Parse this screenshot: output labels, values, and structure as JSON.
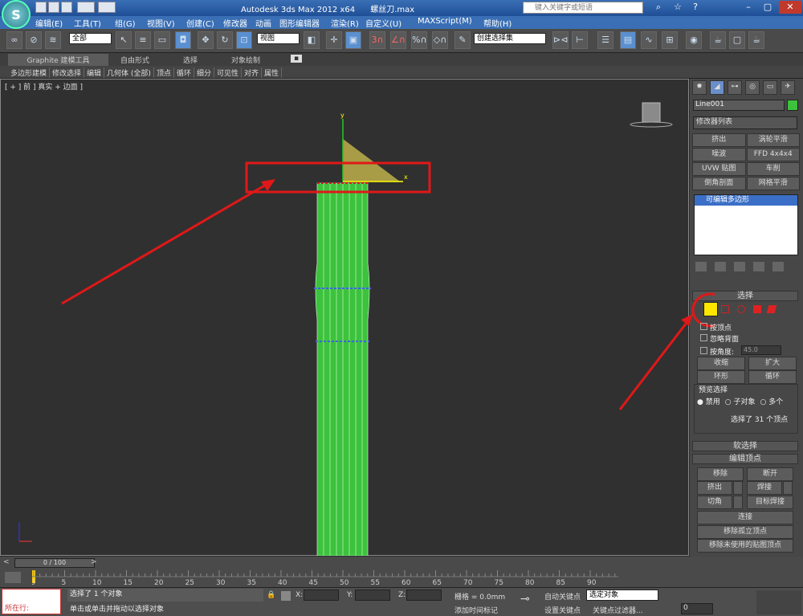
{
  "window": {
    "title": "Autodesk 3ds Max  2012 x64",
    "file": "螺丝刀.max",
    "search_placeholder": "键入关键字或短语",
    "app_icon": "3ds-max-logo-icon"
  },
  "menu": [
    "编辑(E)",
    "工具(T)",
    "组(G)",
    "视图(V)",
    "创建(C)",
    "修改器",
    "动画",
    "图形编辑器",
    "渲染(R)",
    "自定义(U)",
    "MAXScript(M)",
    "帮助(H)"
  ],
  "toolbar": {
    "selection_filter": "全部",
    "coord_system": "视图",
    "named_selection": "创建选择集"
  },
  "ribbon": {
    "tabs": [
      "Graphite 建模工具",
      "自由形式",
      "选择",
      "对象绘制"
    ],
    "subtabs": [
      "多边形建模",
      "修改选择",
      "编辑",
      "几何体 (全部)",
      "顶点",
      "循环",
      "细分",
      "可见性",
      "对齐",
      "属性"
    ]
  },
  "viewport": {
    "label": "[ + ] 前 ] 真实 + 边面 ]",
    "gizmo_y": "y",
    "gizmo_x": "x",
    "viewcube": "前"
  },
  "command_panel": {
    "object_name": "Line001",
    "modifier_list": "修改器列表",
    "buttons": [
      "挤出",
      "涡轮平滑",
      "噪波",
      "FFD 4x4x4",
      "UVW 贴图",
      "车削",
      "倒角剖面",
      "网格平滑"
    ],
    "stack_item": "可编辑多边形",
    "select_rollout": "选择",
    "by_vertex": "按顶点",
    "ignore_backface": "忽略背面",
    "by_angle": "按角度:",
    "angle_value": "45.0",
    "shrink": "收缩",
    "grow": "扩大",
    "ring": "环形",
    "loop": "循环",
    "preview_select": "预览选择",
    "preview_options": [
      "禁用",
      "子对象",
      "多个"
    ],
    "selected_info": "选择了 31 个顶点",
    "soft_select": "软选择",
    "edit_vertices": "编辑顶点",
    "remove": "移除",
    "break": "断开",
    "extrude": "挤出",
    "weld": "焊接",
    "chamfer": "切角",
    "target_weld": "目标焊接",
    "connect": "连接",
    "remove_isolated": "移除孤立顶点",
    "remove_unused": "移除未使用的贴图顶点"
  },
  "timeline": {
    "frame": "0 / 100",
    "ticks": [
      "0",
      "5",
      "10",
      "15",
      "20",
      "25",
      "30",
      "35",
      "40",
      "45",
      "50",
      "55",
      "60",
      "65",
      "70",
      "75",
      "80",
      "85",
      "90"
    ]
  },
  "status": {
    "running": "所在行:",
    "line1": "选择了 1 个对象",
    "line2": "单击或单击并拖动以选择对象",
    "x_label": "X:",
    "y_label": "Y:",
    "z_label": "Z:",
    "grid": "栅格 = 0.0mm",
    "auto_key": "自动关键点",
    "set_key": "设置关键点",
    "selected": "选定对象",
    "key_filter": "关键点过滤器...",
    "add_time_tag": "添加时间标记",
    "frame_field": "0"
  },
  "colors": {
    "object_green": "#3cc23c",
    "highlight_red": "#e01818",
    "vertex_yellow": "#ffe600",
    "title_blue": "#3a6fb5"
  }
}
